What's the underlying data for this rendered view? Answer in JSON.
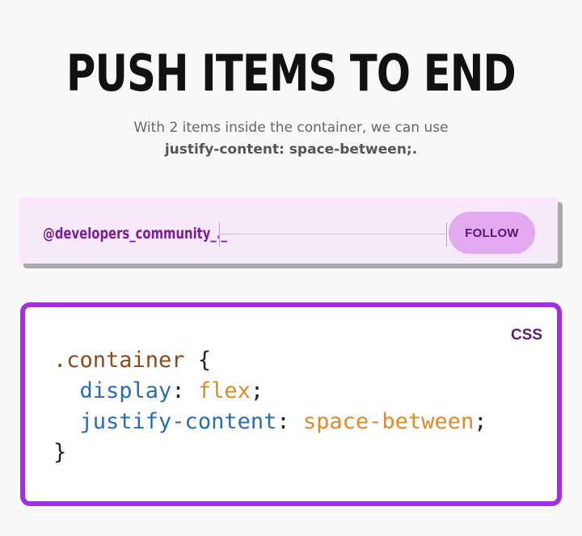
{
  "header": {
    "title": "PUSH ITEMS TO END",
    "subtitle": "With 2 items inside the container, we can use",
    "subtitle_code": "justify-content: space-between;."
  },
  "demo": {
    "handle": "@developers_community_._",
    "follow_label": "FOLLOW"
  },
  "code_panel": {
    "language": "CSS",
    "lines": [
      [
        {
          "t": "selector",
          "v": ".container"
        },
        {
          "t": "punct",
          "v": " {"
        }
      ],
      [
        {
          "t": "punct",
          "v": "  "
        },
        {
          "t": "prop",
          "v": "display"
        },
        {
          "t": "punct",
          "v": ": "
        },
        {
          "t": "value",
          "v": "flex"
        },
        {
          "t": "punct",
          "v": ";"
        }
      ],
      [
        {
          "t": "punct",
          "v": "  "
        },
        {
          "t": "prop",
          "v": "justify-content"
        },
        {
          "t": "punct",
          "v": ": "
        },
        {
          "t": "value",
          "v": "space-between"
        },
        {
          "t": "punct",
          "v": ";"
        }
      ],
      [
        {
          "t": "punct",
          "v": "}"
        }
      ]
    ]
  },
  "colors": {
    "accent_border": "#a42fe0",
    "handle_text": "#7b1d99",
    "button_bg": "#e2a8f0",
    "demo_bg": "#f7e9fa",
    "css_property": "#2b6cb0",
    "css_value": "#e08a2a",
    "css_selector": "#8a4a1a"
  }
}
